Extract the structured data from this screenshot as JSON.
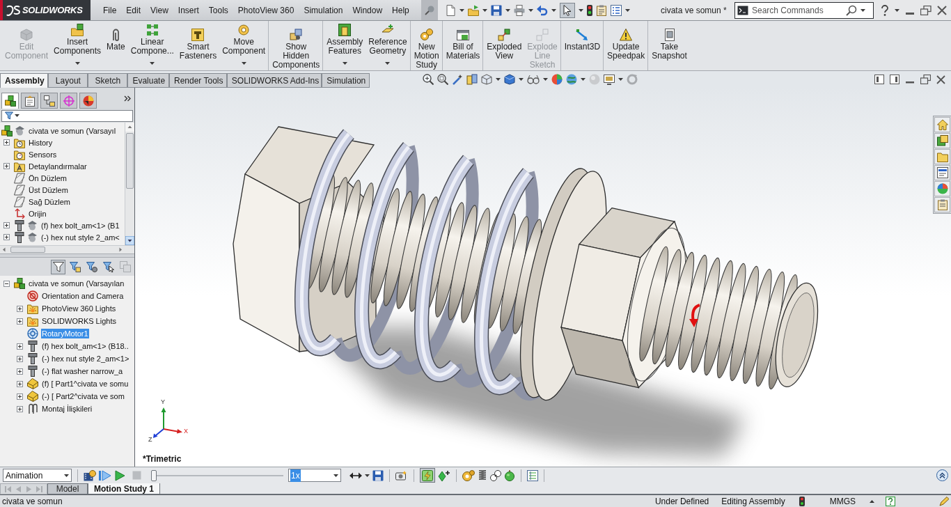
{
  "title_bar": {
    "logo": "SOLIDWORKS",
    "menu": [
      "File",
      "Edit",
      "View",
      "Insert",
      "Tools",
      "PhotoView 360",
      "Simulation",
      "Window",
      "Help"
    ],
    "select_tool": {
      "pressed": true
    },
    "document_title": "civata ve somun *",
    "search": {
      "placeholder": "Search Commands"
    }
  },
  "ribbon": {
    "groups": [
      {
        "buttons": [
          {
            "label": "Edit Component",
            "disabled": true,
            "dropdown": false
          },
          {
            "label": "Insert Components",
            "disabled": false,
            "dropdown": true
          },
          {
            "label": "Mate",
            "disabled": false,
            "dropdown": false
          },
          {
            "label": "Linear Compone...",
            "disabled": false,
            "dropdown": true
          },
          {
            "label": "Smart Fasteners",
            "disabled": false,
            "dropdown": false
          },
          {
            "label": "Move Component",
            "disabled": false,
            "dropdown": true
          }
        ]
      },
      {
        "buttons": [
          {
            "label": "Show Hidden Components",
            "disabled": false,
            "dropdown": false
          }
        ]
      },
      {
        "buttons": [
          {
            "label": "Assembly Features",
            "disabled": false,
            "dropdown": true
          },
          {
            "label": "Reference Geometry",
            "disabled": false,
            "dropdown": true
          }
        ]
      },
      {
        "buttons": [
          {
            "label": "New Motion Study",
            "disabled": false,
            "dropdown": false
          }
        ]
      },
      {
        "buttons": [
          {
            "label": "Bill of Materials",
            "disabled": false,
            "dropdown": false
          }
        ]
      },
      {
        "buttons": [
          {
            "label": "Exploded View",
            "disabled": false,
            "dropdown": false
          },
          {
            "label": "Explode Line Sketch",
            "disabled": true,
            "dropdown": false
          }
        ]
      },
      {
        "buttons": [
          {
            "label": "Instant3D",
            "disabled": false,
            "dropdown": false
          }
        ]
      },
      {
        "buttons": [
          {
            "label": "Update Speedpak",
            "disabled": false,
            "dropdown": false
          }
        ]
      },
      {
        "buttons": [
          {
            "label": "Take Snapshot",
            "disabled": false,
            "dropdown": false
          }
        ]
      }
    ]
  },
  "command_tabs": [
    {
      "label": "Assembly",
      "selected": true
    },
    {
      "label": "Layout",
      "selected": false
    },
    {
      "label": "Sketch",
      "selected": false
    },
    {
      "label": "Evaluate",
      "selected": false
    },
    {
      "label": "Render Tools",
      "selected": false
    },
    {
      "label": "SOLIDWORKS Add-Ins",
      "selected": false
    },
    {
      "label": "Simulation",
      "selected": false
    }
  ],
  "feature_manager": {
    "panel_tabs": [
      {
        "selected": true
      },
      {
        "selected": false
      },
      {
        "selected": false
      },
      {
        "selected": false
      },
      {
        "selected": false
      }
    ],
    "tree": [
      {
        "kind": "assembly",
        "label": "civata ve somun (Varsayıl",
        "selected": false,
        "children": [
          {
            "kind": "history",
            "label": "History",
            "expanded": false,
            "selected": false
          },
          {
            "kind": "sensors",
            "label": "Sensors",
            "selected": false
          },
          {
            "kind": "annotations",
            "label": "Detaylandırmalar",
            "expanded": false,
            "selected": false
          },
          {
            "kind": "plane",
            "label": "Ön Düzlem",
            "selected": false
          },
          {
            "kind": "plane",
            "label": "Üst Düzlem",
            "selected": false
          },
          {
            "kind": "plane",
            "label": "Sağ Düzlem",
            "selected": false
          },
          {
            "kind": "origin",
            "label": "Orijin",
            "selected": false
          },
          {
            "kind": "component",
            "label": "(f) hex bolt_am<1> (B1",
            "expanded": false,
            "selected": false
          },
          {
            "kind": "component",
            "label": "(-) hex nut style 2_am<",
            "expanded": false,
            "selected": false
          }
        ]
      }
    ]
  },
  "motion_manager": {
    "filters": [
      {
        "pressed": true,
        "disabled": false
      },
      {
        "pressed": false,
        "disabled": false
      },
      {
        "pressed": false,
        "disabled": false
      },
      {
        "pressed": false,
        "disabled": false
      },
      {
        "pressed": false,
        "disabled": true
      }
    ],
    "tree": [
      {
        "kind": "assembly",
        "label": "civata ve somun (Varsayılan",
        "expanded": true,
        "selected": false,
        "children": [
          {
            "kind": "orientation",
            "label": "Orientation and Camera",
            "selected": false
          },
          {
            "kind": "lights",
            "label": "PhotoView 360 Lights",
            "expanded": false,
            "selected": false
          },
          {
            "kind": "lights",
            "label": "SOLIDWORKS Lights",
            "expanded": false,
            "selected": false
          },
          {
            "kind": "motor",
            "label": "RotaryMotor1",
            "selected": true
          },
          {
            "kind": "part",
            "label": "(f) hex bolt_am<1> (B18..",
            "expanded": false,
            "selected": false
          },
          {
            "kind": "part",
            "label": "(-) hex nut style 2_am<1>",
            "expanded": false,
            "selected": false
          },
          {
            "kind": "part",
            "label": "(-) flat washer narrow_a",
            "expanded": false,
            "selected": false
          },
          {
            "kind": "subassembly",
            "label": "(f) [ Part1^civata ve somu",
            "expanded": false,
            "selected": false
          },
          {
            "kind": "subassembly",
            "label": "(-) [ Part2^civata ve som",
            "expanded": false,
            "selected": false
          },
          {
            "kind": "mates",
            "label": "Montaj İlişkileri",
            "expanded": false,
            "selected": false
          }
        ]
      }
    ]
  },
  "viewport": {
    "view_name": "*Trimetric",
    "triad": {
      "x": "X",
      "y": "Y",
      "z": "Z"
    }
  },
  "motion_bar": {
    "study_type": "Animation",
    "stop": {
      "disabled": true
    },
    "timeline": {
      "level": 0
    },
    "speed": "1x",
    "autokey": {
      "pressed": true
    }
  },
  "study_tabs": [
    {
      "label": "Model",
      "selected": false
    },
    {
      "label": "Motion Study 1",
      "selected": true
    }
  ],
  "status_bar": {
    "document": "civata ve somun",
    "definition": "Under Defined",
    "mode": "Editing Assembly",
    "units": "MMGS"
  }
}
